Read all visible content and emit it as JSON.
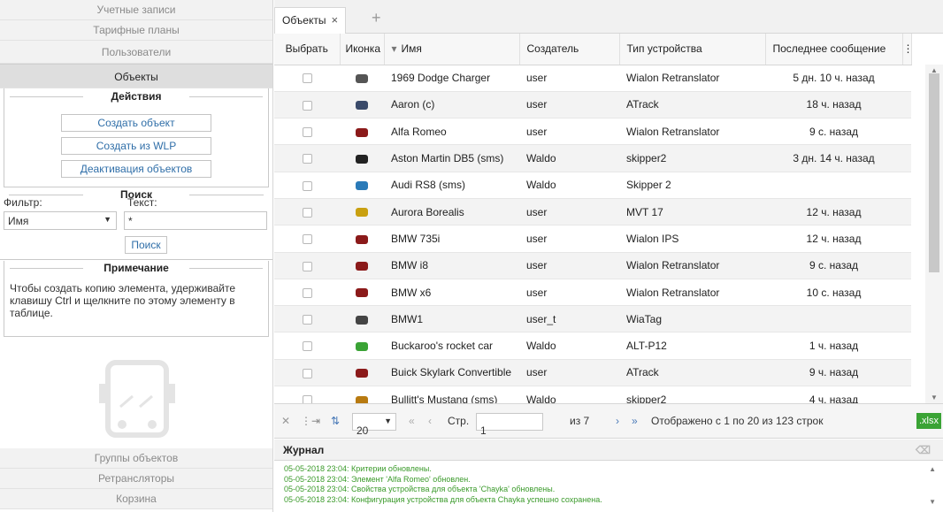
{
  "sidebar": {
    "items": [
      "Учетные записи",
      "Тарифные планы",
      "Пользователи",
      "Объекты"
    ],
    "bottom_items": [
      "Группы объектов",
      "Ретрансляторы",
      "Корзина"
    ]
  },
  "actions": {
    "title": "Действия",
    "buttons": [
      "Создать объект",
      "Создать из WLP",
      "Деактивация объектов"
    ]
  },
  "search": {
    "title": "Поиск",
    "filter_label": "Фильтр:",
    "text_label": "Текст:",
    "filter_value": "Имя",
    "text_value": "*",
    "button": "Поиск"
  },
  "note": {
    "title": "Примечание",
    "text": "Чтобы создать копию элемента, удерживайте клавишу Ctrl и щелкните по этому элементу в таблице."
  },
  "tabs": {
    "active": "Объекты",
    "close": "×",
    "add": "+"
  },
  "table": {
    "columns": [
      "Выбрать",
      "Иконка",
      "Имя",
      "Создатель",
      "Тип устройства",
      "Последнее сообщение"
    ],
    "sort_indicator": "▾",
    "rows": [
      {
        "name": "1969 Dodge Charger",
        "creator": "user",
        "device": "Wialon Retranslator",
        "last": "5 дн. 10 ч. назад",
        "icon_color": "#555555"
      },
      {
        "name": "Aaron (c)",
        "creator": "user",
        "device": "ATrack",
        "last": "18 ч. назад",
        "icon_color": "#3a4a6a"
      },
      {
        "name": "Alfa Romeo",
        "creator": "user",
        "device": "Wialon Retranslator",
        "last": "9 с. назад",
        "icon_color": "#8b1a1a"
      },
      {
        "name": "Aston Martin DB5 (sms)",
        "creator": "Waldo",
        "device": "skipper2",
        "last": "3 дн. 14 ч. назад",
        "icon_color": "#222222"
      },
      {
        "name": "Audi RS8 (sms)",
        "creator": "Waldo",
        "device": "Skipper 2",
        "last": "",
        "icon_color": "#2a7ab8"
      },
      {
        "name": "Aurora Borealis",
        "creator": "user",
        "device": "MVT 17",
        "last": "12 ч. назад",
        "icon_color": "#c9a010"
      },
      {
        "name": "BMW 735i",
        "creator": "user",
        "device": "Wialon IPS",
        "last": "12 ч. назад",
        "icon_color": "#8b1a1a"
      },
      {
        "name": "BMW i8",
        "creator": "user",
        "device": "Wialon Retranslator",
        "last": "9 с. назад",
        "icon_color": "#8b1a1a"
      },
      {
        "name": "BMW x6",
        "creator": "user",
        "device": "Wialon Retranslator",
        "last": "10 с. назад",
        "icon_color": "#8b1a1a"
      },
      {
        "name": "BMW1",
        "creator": "user_t",
        "device": "WiaTag",
        "last": "",
        "icon_color": "#444444"
      },
      {
        "name": "Buckaroo's rocket car",
        "creator": "Waldo",
        "device": "ALT-P12",
        "last": "1 ч. назад",
        "icon_color": "#3aa335"
      },
      {
        "name": "Buick Skylark Convertible",
        "creator": "user",
        "device": "ATrack",
        "last": "9 ч. назад",
        "icon_color": "#8b1a1a"
      },
      {
        "name": "Bullitt's Mustang (sms)",
        "creator": "Waldo",
        "device": "skipper2",
        "last": "4 ч. назад",
        "icon_color": "#b87a10"
      }
    ]
  },
  "pager": {
    "per_page": "20",
    "page_label": "Стр.",
    "page": "1",
    "of": "из 7",
    "showing": "Отображено с 1 по 20 из 123 строк",
    "export": ".xlsx"
  },
  "journal": {
    "title": "Журнал",
    "lines": [
      "05-05-2018 23:04: Критерии обновлены.",
      "05-05-2018 23:04: Элемент 'Alfa Romeo' обновлен.",
      "05-05-2018 23:04: Свойства устройства для объекта 'Chayka' обновлены.",
      "05-05-2018 23:04: Конфигурация устройства для объекта Chayka успешно сохранена."
    ]
  }
}
